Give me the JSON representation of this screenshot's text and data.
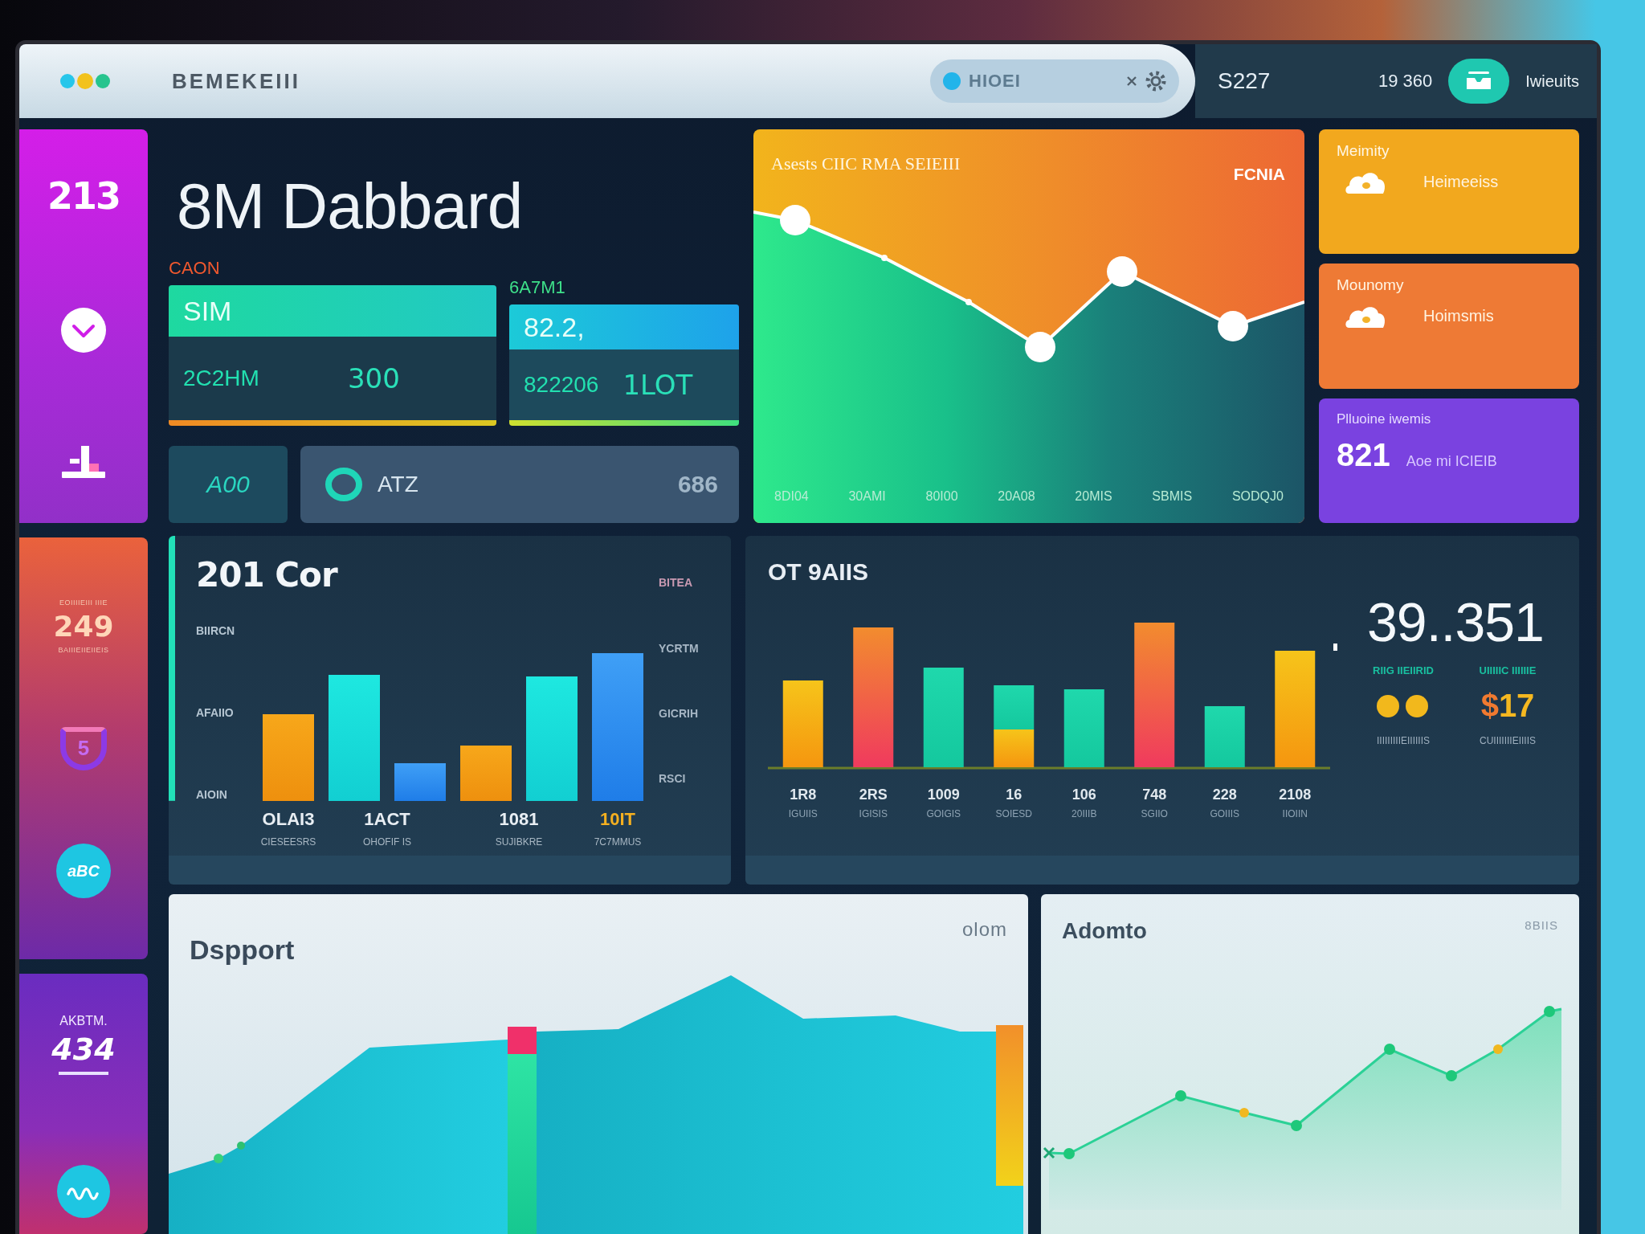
{
  "window": {
    "title": "BEMEKEIII"
  },
  "header": {
    "search": {
      "placeholder": "HIOEI"
    },
    "stats": [
      "S227",
      "19 360"
    ],
    "user": "Iwieuits"
  },
  "sidebar": {
    "cards": [
      {
        "kind": "nav",
        "value": "213"
      },
      {
        "kind": "score",
        "caption_top": "EOIIIIEIII IIIE",
        "value": "249",
        "caption_bottom": "BAIIIEIIEIIEIS",
        "badge": "5",
        "chip": "aBC"
      },
      {
        "kind": "total",
        "caption_top": "AKBTM.",
        "value": "434"
      }
    ]
  },
  "dashboard": {
    "title": "8M Dabbard",
    "stat_cards": [
      {
        "label": "CAON",
        "header": "SIM",
        "caption": "2C2HM",
        "value": "300"
      },
      {
        "label": "6A7M1",
        "header": "82.2,",
        "caption": "822206",
        "value": "1LOT"
      }
    ],
    "mini_cards": [
      {
        "kind": "code",
        "text": "A00"
      },
      {
        "kind": "asset",
        "text": "ATZ",
        "value": "686"
      }
    ],
    "trend": {
      "title": "Asests CIIC RMA SEIEIII",
      "tag": "FCNIA",
      "x_labels": [
        "8DI04",
        "30AMI",
        "80I00",
        "20A08",
        "20MIS",
        "SBMIS",
        "SODQJ0"
      ]
    },
    "notices": [
      {
        "kind": "alert",
        "title": "Meimity",
        "text": "Heimeeiss",
        "color": "#f2a81e"
      },
      {
        "kind": "alert",
        "title": "Mounomy",
        "text": "Hoimsmis",
        "color": "#ee7a35"
      },
      {
        "kind": "metric",
        "title": "Plluoine iwemis",
        "value": "821",
        "text": "Aoe mi ICIEIB",
        "color": "#7a42e0"
      }
    ],
    "revenue_chart": {
      "title": "201 Cor",
      "y_labels": [
        "BIIRCN",
        "AFAIIO",
        "AIOIN"
      ],
      "legend": [
        "BITEA",
        "YCRTM",
        "GICRIH",
        "RSCI"
      ],
      "groups": [
        {
          "value": "OLAI3",
          "caption": "CIESEESRS",
          "highlighted": false
        },
        {
          "value": "1ACT",
          "caption": "OHOFIF IS",
          "highlighted": false
        },
        {
          "value": "1081",
          "caption": "SUJIBKRE",
          "highlighted": false
        },
        {
          "value": "10IT",
          "caption": "7C7MMUS",
          "highlighted": true
        }
      ]
    },
    "activity_chart": {
      "title": "OT 9AIIS",
      "bars": [
        {
          "value": "1R8",
          "caption": "IGUIIS"
        },
        {
          "value": "2RS",
          "caption": "IGISIS"
        },
        {
          "value": "1009",
          "caption": "GOIGIS"
        },
        {
          "value": "16",
          "caption": "SOIESD"
        },
        {
          "value": "106",
          "caption": "20IIIB"
        },
        {
          "value": "748",
          "caption": "SGIIO"
        },
        {
          "value": "228",
          "caption": "GOIIIS"
        },
        {
          "value": "2108",
          "caption": "IIOIIN"
        }
      ],
      "total": "39..351",
      "labels": [
        "RIIG IIEIIRID",
        "UIIIIIC IIIIIIE"
      ],
      "captions": [
        "IIIIIIIIIEIIIIIIS",
        "CUIIIIIIIEIIIIS"
      ],
      "price": {
        "currency": "$",
        "amount": "17"
      }
    },
    "area_panel": {
      "title": "Dspport",
      "tag": "olom"
    },
    "line_panel": {
      "title": "Adomto",
      "tag": "8BIIS"
    }
  }
}
